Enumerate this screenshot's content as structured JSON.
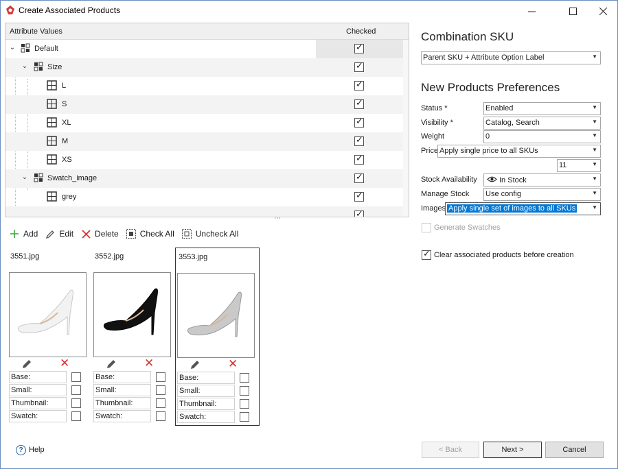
{
  "window": {
    "title": "Create Associated Products"
  },
  "grid": {
    "col_attribute": "Attribute Values",
    "col_checked": "Checked",
    "rows": [
      {
        "label": "Default",
        "checked": true
      },
      {
        "label": "Size",
        "checked": true
      },
      {
        "label": "L",
        "checked": true
      },
      {
        "label": "S",
        "checked": true
      },
      {
        "label": "XL",
        "checked": true
      },
      {
        "label": "M",
        "checked": true
      },
      {
        "label": "XS",
        "checked": true
      },
      {
        "label": "Swatch_image",
        "checked": true
      },
      {
        "label": "grey",
        "checked": true
      }
    ]
  },
  "toolbar": {
    "add": "Add",
    "edit": "Edit",
    "delete": "Delete",
    "check_all": "Check All",
    "uncheck_all": "Uncheck All"
  },
  "images": [
    {
      "filename": "3551.jpg",
      "shoe_color": "#f2f2f2"
    },
    {
      "filename": "3552.jpg",
      "shoe_color": "#111111"
    },
    {
      "filename": "3553.jpg",
      "shoe_color": "#c9c9c9"
    }
  ],
  "image_flags": {
    "base": "Base:",
    "small": "Small:",
    "thumbnail": "Thumbnail:",
    "swatch": "Swatch:"
  },
  "combination_sku": {
    "heading": "Combination SKU",
    "value": "Parent SKU + Attribute Option Label"
  },
  "preferences": {
    "heading": "New Products Preferences",
    "status_label": "Status *",
    "status_value": "Enabled",
    "visibility_label": "Visibility *",
    "visibility_value": "Catalog, Search",
    "weight_label": "Weight",
    "weight_value": "0",
    "price_label": "Price",
    "price_value": "Apply single price to all SKUs",
    "price_extra_value": "11",
    "stock_label": "Stock Availability",
    "stock_value": "In Stock",
    "manage_stock_label": "Manage Stock",
    "manage_stock_value": "Use config",
    "images_label": "Images",
    "images_value": "Apply single set of images to all SKUs",
    "generate_swatches": "Generate Swatches",
    "clear_associated": "Clear associated products before creation",
    "clear_associated_checked": true
  },
  "footer": {
    "help": "Help",
    "back": "< Back",
    "next": "Next >",
    "cancel": "Cancel"
  },
  "colors": {
    "accent": "#0078d7",
    "delete_red": "#d83030",
    "add_green": "#3aa845"
  }
}
